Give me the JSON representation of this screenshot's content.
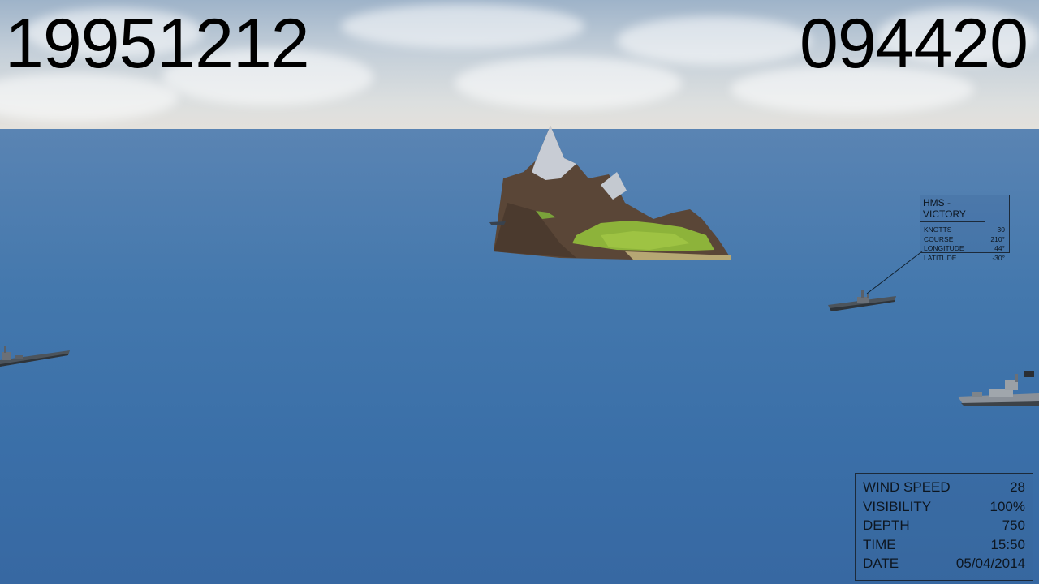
{
  "overlay": {
    "date_code": "19951212",
    "time_code": "094420"
  },
  "ship_info": {
    "name": "HMS - VICTORY",
    "fields": [
      {
        "label": "KNOTTS",
        "value": "30"
      },
      {
        "label": "COURSE",
        "value": "210°"
      },
      {
        "label": "LONGITUDE",
        "value": "44°"
      },
      {
        "label": "LATITUDE",
        "value": "-30°"
      }
    ]
  },
  "environment": {
    "fields": [
      {
        "label": "WIND SPEED",
        "value": "28"
      },
      {
        "label": "VISIBILITY",
        "value": "100%"
      },
      {
        "label": "DEPTH",
        "value": "750"
      },
      {
        "label": "TIME",
        "value": "15:50"
      },
      {
        "label": "DATE",
        "value": "05/04/2014"
      }
    ]
  },
  "colors": {
    "sea": "#3b6ea3",
    "panel_border": "#1c2a3a",
    "text": "#000000"
  }
}
